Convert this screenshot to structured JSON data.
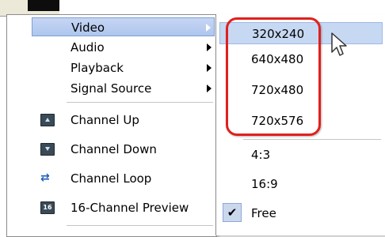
{
  "main_menu": {
    "submenus": [
      {
        "label": "Video",
        "highlighted": true
      },
      {
        "label": "Audio",
        "highlighted": false
      },
      {
        "label": "Playback",
        "highlighted": false
      },
      {
        "label": "Signal Source",
        "highlighted": false
      }
    ],
    "commands": [
      {
        "label": "Channel Up",
        "icon": "channel-up-icon"
      },
      {
        "label": "Channel Down",
        "icon": "channel-down-icon"
      },
      {
        "label": "Channel Loop",
        "icon": "loop-icon"
      },
      {
        "label": "16-Channel Preview",
        "icon": "preview-16-icon",
        "icon_text": "16"
      }
    ]
  },
  "video_submenu": {
    "resolutions": [
      {
        "label": "320x240",
        "selected": true
      },
      {
        "label": "640x480",
        "selected": false
      },
      {
        "label": "720x480",
        "selected": false
      },
      {
        "label": "720x576",
        "selected": false
      }
    ],
    "aspect_ratios": [
      {
        "label": "4:3",
        "checked": false
      },
      {
        "label": "16:9",
        "checked": false
      },
      {
        "label": "Free",
        "checked": true
      }
    ],
    "check_mark": "✔"
  },
  "colors": {
    "highlight": "#c6d5f3",
    "annotation_ring": "#e0201d"
  }
}
